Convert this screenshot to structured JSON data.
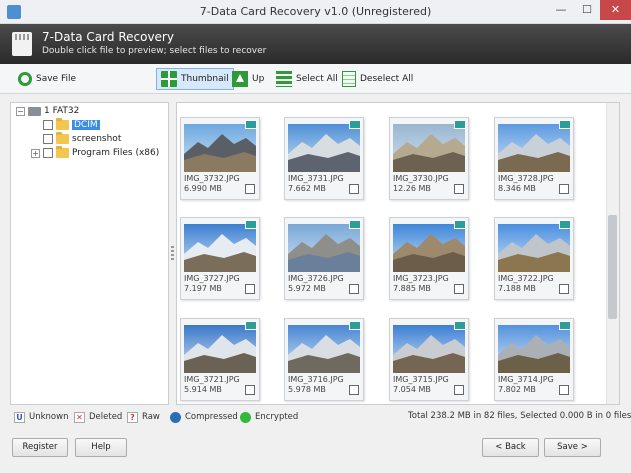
{
  "window": {
    "title": "7-Data Card Recovery v1.0 (Unregistered)",
    "minimize": "—",
    "maximize": "☐",
    "close": "✕"
  },
  "header": {
    "title": "7-Data Card Recovery",
    "subtitle": "Double click file to preview; select files to recover"
  },
  "toolbar": {
    "save_file_label": "Save File",
    "thumbnail_label": "Thumbnail",
    "up_label": "Up",
    "select_all_label": "Select All",
    "deselect_all_label": "Deselect All"
  },
  "tree": {
    "root_label": "1 FAT32",
    "items": [
      {
        "label": "DCIM",
        "selected": true
      },
      {
        "label": "screenshot",
        "selected": false
      },
      {
        "label": "Program Files (x86)",
        "selected": false
      }
    ]
  },
  "files": [
    {
      "name": "IMG_3732.JPG",
      "size": "6.990 MB"
    },
    {
      "name": "IMG_3731.JPG",
      "size": "7.662 MB"
    },
    {
      "name": "IMG_3730.JPG",
      "size": "12.26 MB"
    },
    {
      "name": "IMG_3728.JPG",
      "size": "8.346 MB"
    },
    {
      "name": "IMG_3727.JPG",
      "size": "7.197 MB"
    },
    {
      "name": "IMG_3726.JPG",
      "size": "5.972 MB"
    },
    {
      "name": "IMG_3723.JPG",
      "size": "7.885 MB"
    },
    {
      "name": "IMG_3722.JPG",
      "size": "7.188 MB"
    },
    {
      "name": "IMG_3721.JPG",
      "size": "5.914 MB"
    },
    {
      "name": "IMG_3716.JPG",
      "size": "5.978 MB"
    },
    {
      "name": "IMG_3715.JPG",
      "size": "7.054 MB"
    },
    {
      "name": "IMG_3714.JPG",
      "size": "7.802 MB"
    }
  ],
  "legend": {
    "unknown": "Unknown",
    "deleted": "Deleted",
    "raw": "Raw",
    "compressed": "Compressed",
    "encrypted": "Encrypted",
    "unknown_glyph": "U",
    "deleted_glyph": "✕",
    "raw_glyph": "?"
  },
  "status": "Total 238.2 MB in 82 files, Selected 0.000 B in 0 files.",
  "buttons": {
    "register": "Register",
    "help": "Help",
    "back": "< Back",
    "save": "Save >"
  },
  "colors": {
    "accent": "#3a8ee6",
    "toolbar_green": "#2f9a38",
    "close_red": "#c74848",
    "compressed": "#2a6fb3",
    "encrypted": "#33b83b"
  }
}
